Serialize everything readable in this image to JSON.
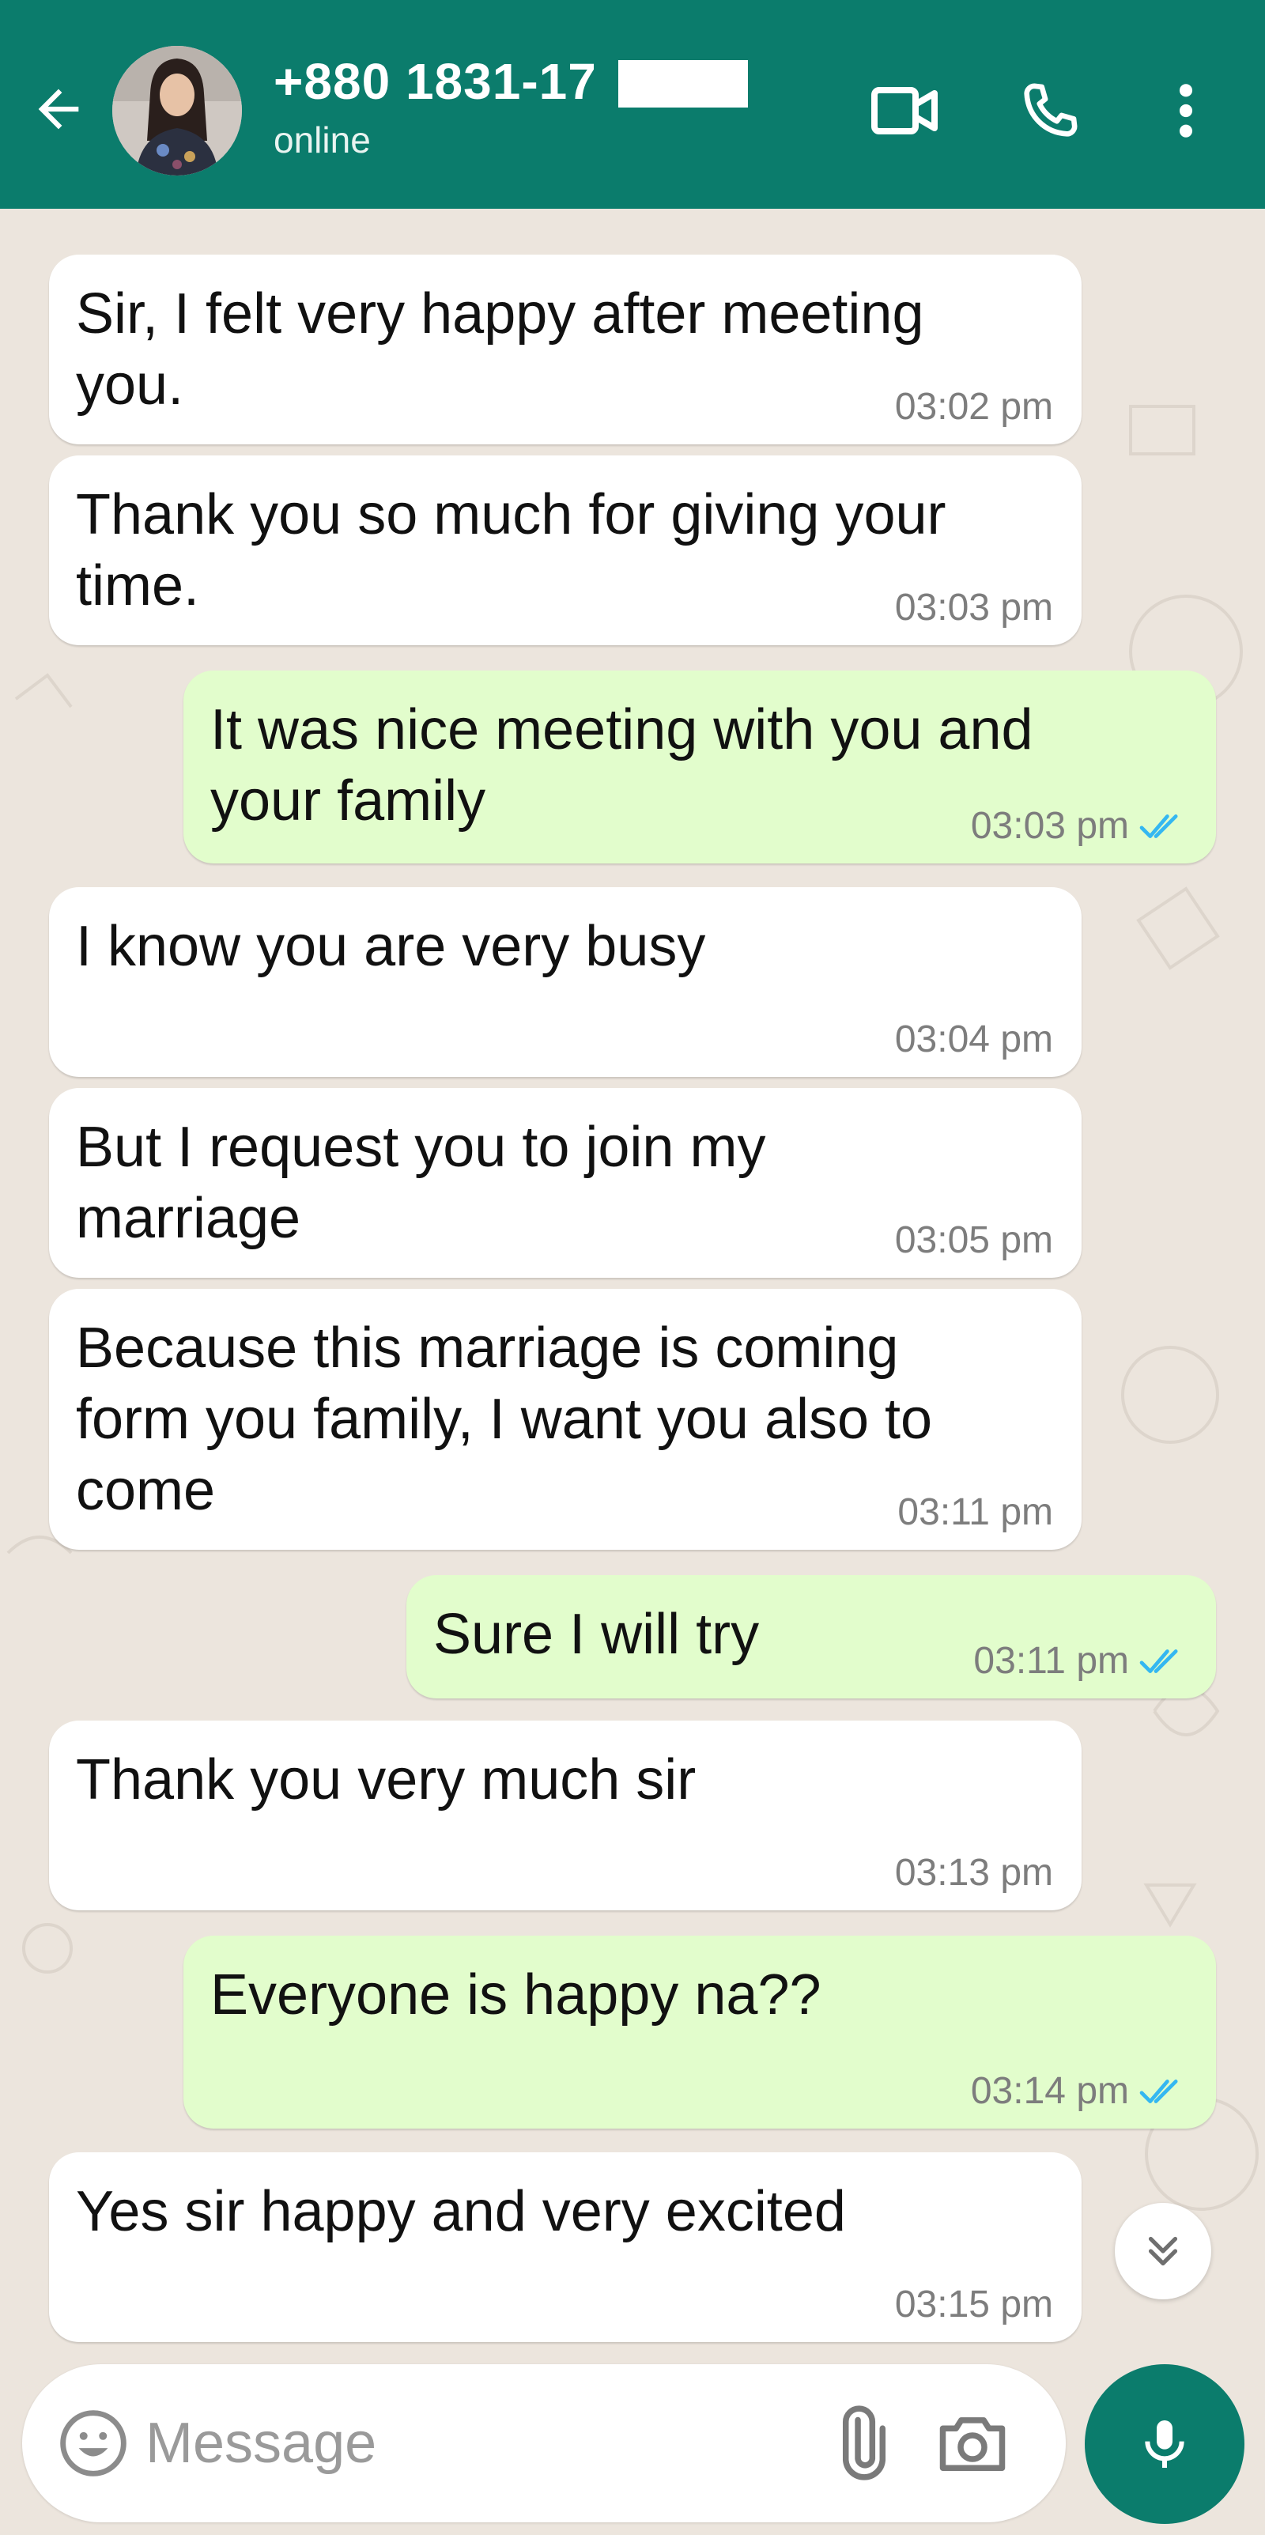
{
  "header": {
    "contact_name": "+880 1831-17",
    "status": "online",
    "icons": {
      "back": "arrow-left-icon",
      "video": "video-camera-icon",
      "call": "phone-icon",
      "menu": "more-vert-icon"
    }
  },
  "messages": [
    {
      "direction": "in",
      "text": "Sir, I felt very happy after meeting\nyou.",
      "time": "03:02 pm"
    },
    {
      "direction": "in",
      "text": "Thank you so much for giving your\ntime.",
      "time": "03:03 pm"
    },
    {
      "direction": "out",
      "text": "It was nice meeting with you and\nyour family",
      "time": "03:03 pm",
      "read": true
    },
    {
      "direction": "in",
      "text": "I know you are very busy",
      "time": "03:04 pm"
    },
    {
      "direction": "in",
      "text": "But I request you to join my\nmarriage",
      "time": "03:05 pm"
    },
    {
      "direction": "in",
      "text": "Because this marriage is coming\nform you family, I want you also to\ncome",
      "time": "03:11 pm"
    },
    {
      "direction": "out",
      "text": "Sure I will try",
      "time": "03:11 pm",
      "read": true
    },
    {
      "direction": "in",
      "text": "Thank you very much sir",
      "time": "03:13 pm"
    },
    {
      "direction": "out",
      "text": "Everyone is happy na??",
      "time": "03:14 pm",
      "read": true
    },
    {
      "direction": "in",
      "text": "Yes sir happy and very excited",
      "time": "03:15 pm"
    }
  ],
  "input": {
    "placeholder": "Message",
    "value": ""
  },
  "colors": {
    "header": "#0b7c6c",
    "chat_bg": "#ece5dd",
    "incoming": "#ffffff",
    "outgoing": "#e2fdcc",
    "read_tick": "#34b7f1"
  }
}
